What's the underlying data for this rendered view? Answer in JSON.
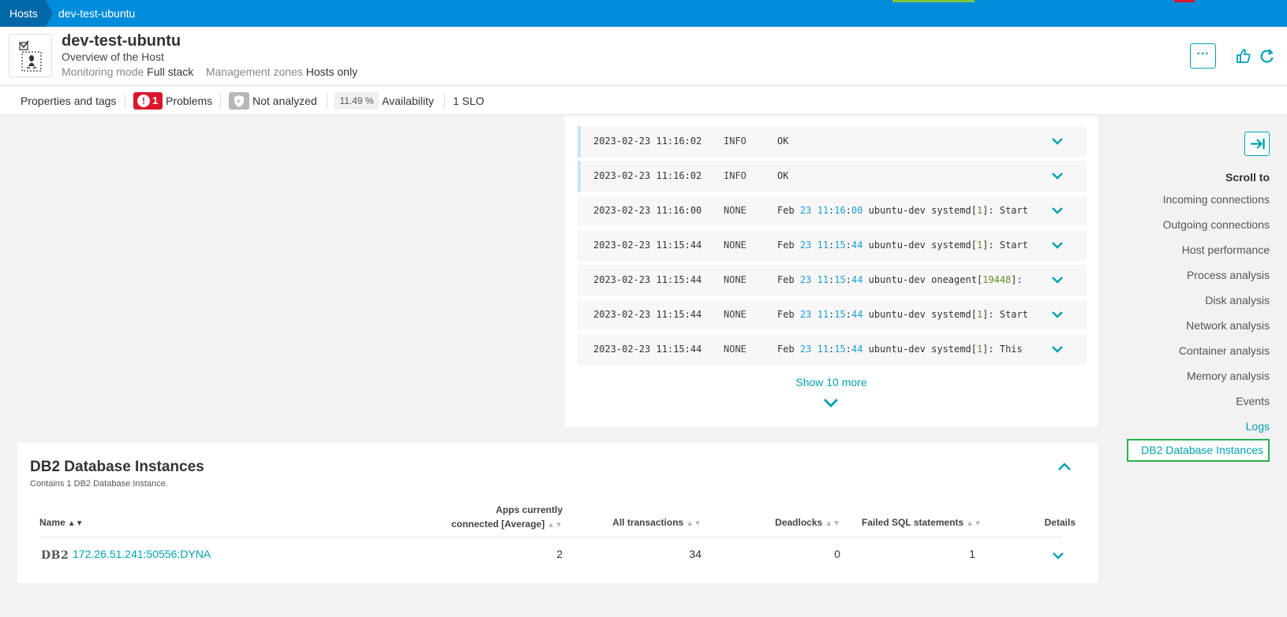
{
  "breadcrumb": {
    "root": "Hosts",
    "current": "dev-test-ubuntu"
  },
  "header": {
    "title": "dev-test-ubuntu",
    "subtitle": "Overview of the Host",
    "monitoring_label": "Monitoring mode",
    "monitoring_value": "Full stack",
    "zones_label": "Management zones",
    "zones_value": "Hosts only",
    "more_label": "···"
  },
  "tabs": {
    "properties": "Properties and tags",
    "problems_count": "1",
    "problems": "Problems",
    "not_analyzed": "Not analyzed",
    "availability_value": "11.49 %",
    "availability": "Availability",
    "slo": "1 SLO"
  },
  "logs": {
    "rows": [
      {
        "ts": "2023-02-23 11:16:02",
        "level": "INFO",
        "msg": "OK",
        "kind": "info"
      },
      {
        "ts": "2023-02-23 11:16:02",
        "level": "INFO",
        "msg": "OK",
        "kind": "info"
      },
      {
        "ts": "2023-02-23 11:16:00",
        "level": "NONE",
        "msg_pre": "Feb ",
        "d": "23",
        "h": "11",
        "m": "16",
        "s": "00",
        "proc": "ubuntu-dev systemd",
        "pid": "1",
        "tail": ": Start",
        "kind": "none"
      },
      {
        "ts": "2023-02-23 11:15:44",
        "level": "NONE",
        "msg_pre": "Feb ",
        "d": "23",
        "h": "11",
        "m": "15",
        "s": "44",
        "proc": "ubuntu-dev systemd",
        "pid": "1",
        "tail": ": Start",
        "kind": "none"
      },
      {
        "ts": "2023-02-23 11:15:44",
        "level": "NONE",
        "msg_pre": "Feb ",
        "d": "23",
        "h": "11",
        "m": "15",
        "s": "44",
        "proc": "ubuntu-dev oneagent",
        "pid": "19448",
        "tail": ":",
        "kind": "none"
      },
      {
        "ts": "2023-02-23 11:15:44",
        "level": "NONE",
        "msg_pre": "Feb ",
        "d": "23",
        "h": "11",
        "m": "15",
        "s": "44",
        "proc": "ubuntu-dev systemd",
        "pid": "1",
        "tail": ": Start",
        "kind": "none"
      },
      {
        "ts": "2023-02-23 11:15:44",
        "level": "NONE",
        "msg_pre": "Feb ",
        "d": "23",
        "h": "11",
        "m": "15",
        "s": "44",
        "proc": "ubuntu-dev systemd",
        "pid": "1",
        "tail": ": This",
        "kind": "none"
      }
    ],
    "show_more": "Show 10 more"
  },
  "scroll_to": {
    "title": "Scroll to",
    "items": [
      "Incoming connections",
      "Outgoing connections",
      "Host performance",
      "Process analysis",
      "Disk analysis",
      "Network analysis",
      "Container analysis",
      "Memory analysis",
      "Events",
      "Logs",
      "DB2 Database Instances"
    ]
  },
  "db2": {
    "title": "DB2 Database Instances",
    "subtitle": "Contains 1 DB2 Database Instance.",
    "columns": {
      "name": "Name",
      "apps_line1": "Apps currently",
      "apps_line2": "connected [Average]",
      "transactions": "All transactions",
      "deadlocks": "Deadlocks",
      "failed_sql": "Failed SQL statements",
      "details": "Details"
    },
    "rows": [
      {
        "logo": "DB2",
        "name": "172.26.51.241:50556:DYNA",
        "apps": "2",
        "transactions": "34",
        "deadlocks": "0",
        "failed_sql": "1"
      }
    ]
  },
  "colors": {
    "primary": "#008cdb",
    "accent": "#00a1b2",
    "danger": "#dc172a",
    "highlight": "#2ab24b"
  }
}
